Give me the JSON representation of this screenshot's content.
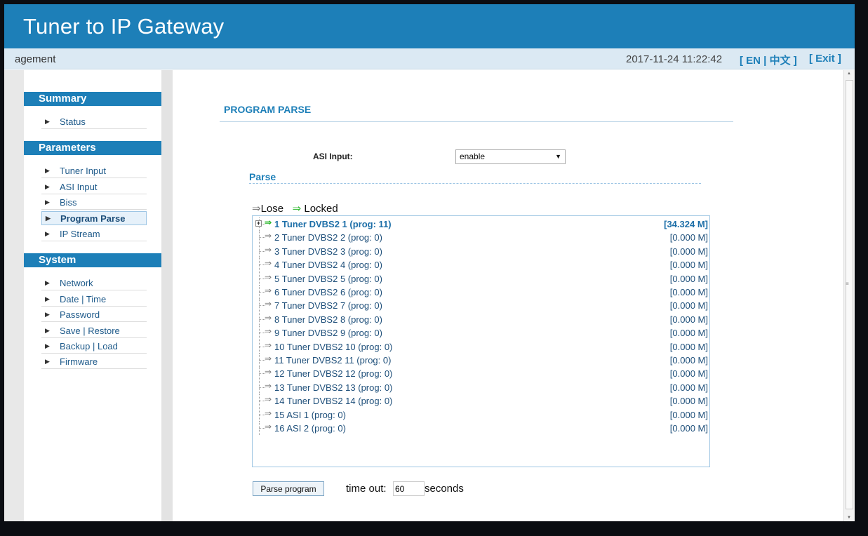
{
  "header": {
    "title": "Tuner to IP Gateway"
  },
  "statusbar": {
    "crumb": "agement",
    "datetime": "2017-11-24 11:22:42",
    "lang_open": "[ ",
    "lang_en": "EN",
    "lang_sep": " | ",
    "lang_zh": "中文",
    "lang_close": " ]",
    "exit": "[ Exit ]"
  },
  "sidebar": {
    "sections": [
      {
        "title": "Summary",
        "items": [
          "Status"
        ]
      },
      {
        "title": "Parameters",
        "items": [
          "Tuner Input",
          "ASI Input",
          "Biss",
          "Program Parse",
          "IP Stream"
        ]
      },
      {
        "title": "System",
        "items": [
          "Network",
          "Date | Time",
          "Password",
          "Save | Restore",
          "Backup | Load",
          "Firmware"
        ]
      }
    ],
    "active_item": "Program Parse",
    "arrow_glyph": "▶"
  },
  "main": {
    "page_title": "PROGRAM PARSE",
    "asi_input": {
      "label": "ASI Input:",
      "value": "enable"
    },
    "parse": {
      "title": "Parse",
      "legend": {
        "lose_arrow": "⇒",
        "lose_label": "Lose",
        "locked_arrow": "⇒",
        "locked_label": "Locked"
      },
      "tree": [
        {
          "label": "1 Tuner DVBS2 1 (prog: 11)",
          "rate": "[34.324 M]",
          "locked": true,
          "expandable": true
        },
        {
          "label": "2 Tuner DVBS2 2 (prog: 0)",
          "rate": "[0.000 M]",
          "locked": false
        },
        {
          "label": "3 Tuner DVBS2 3 (prog: 0)",
          "rate": "[0.000 M]",
          "locked": false
        },
        {
          "label": "4 Tuner DVBS2 4 (prog: 0)",
          "rate": "[0.000 M]",
          "locked": false
        },
        {
          "label": "5 Tuner DVBS2 5 (prog: 0)",
          "rate": "[0.000 M]",
          "locked": false
        },
        {
          "label": "6 Tuner DVBS2 6 (prog: 0)",
          "rate": "[0.000 M]",
          "locked": false
        },
        {
          "label": "7 Tuner DVBS2 7 (prog: 0)",
          "rate": "[0.000 M]",
          "locked": false
        },
        {
          "label": "8 Tuner DVBS2 8 (prog: 0)",
          "rate": "[0.000 M]",
          "locked": false
        },
        {
          "label": "9 Tuner DVBS2 9 (prog: 0)",
          "rate": "[0.000 M]",
          "locked": false
        },
        {
          "label": "10 Tuner DVBS2 10 (prog: 0)",
          "rate": "[0.000 M]",
          "locked": false
        },
        {
          "label": "11 Tuner DVBS2 11 (prog: 0)",
          "rate": "[0.000 M]",
          "locked": false
        },
        {
          "label": "12 Tuner DVBS2 12 (prog: 0)",
          "rate": "[0.000 M]",
          "locked": false
        },
        {
          "label": "13 Tuner DVBS2 13 (prog: 0)",
          "rate": "[0.000 M]",
          "locked": false
        },
        {
          "label": "14 Tuner DVBS2 14 (prog: 0)",
          "rate": "[0.000 M]",
          "locked": false
        },
        {
          "label": "15 ASI 1 (prog: 0)",
          "rate": "[0.000 M]",
          "locked": false
        },
        {
          "label": "16 ASI 2 (prog: 0)",
          "rate": "[0.000 M]",
          "locked": false
        }
      ]
    },
    "parse_button": "Parse program",
    "timeout": {
      "label": "time out:",
      "value": "60",
      "unit": "seconds"
    }
  },
  "colors": {
    "brand": "#1d7fb8",
    "locked_arrow": "#2eb82e",
    "lose_arrow": "#777777"
  },
  "icons": {
    "tree_expand": "plus-box-icon",
    "stream_arrow": "double-arrow-icon",
    "nav_arrow": "triangle-right-icon"
  }
}
